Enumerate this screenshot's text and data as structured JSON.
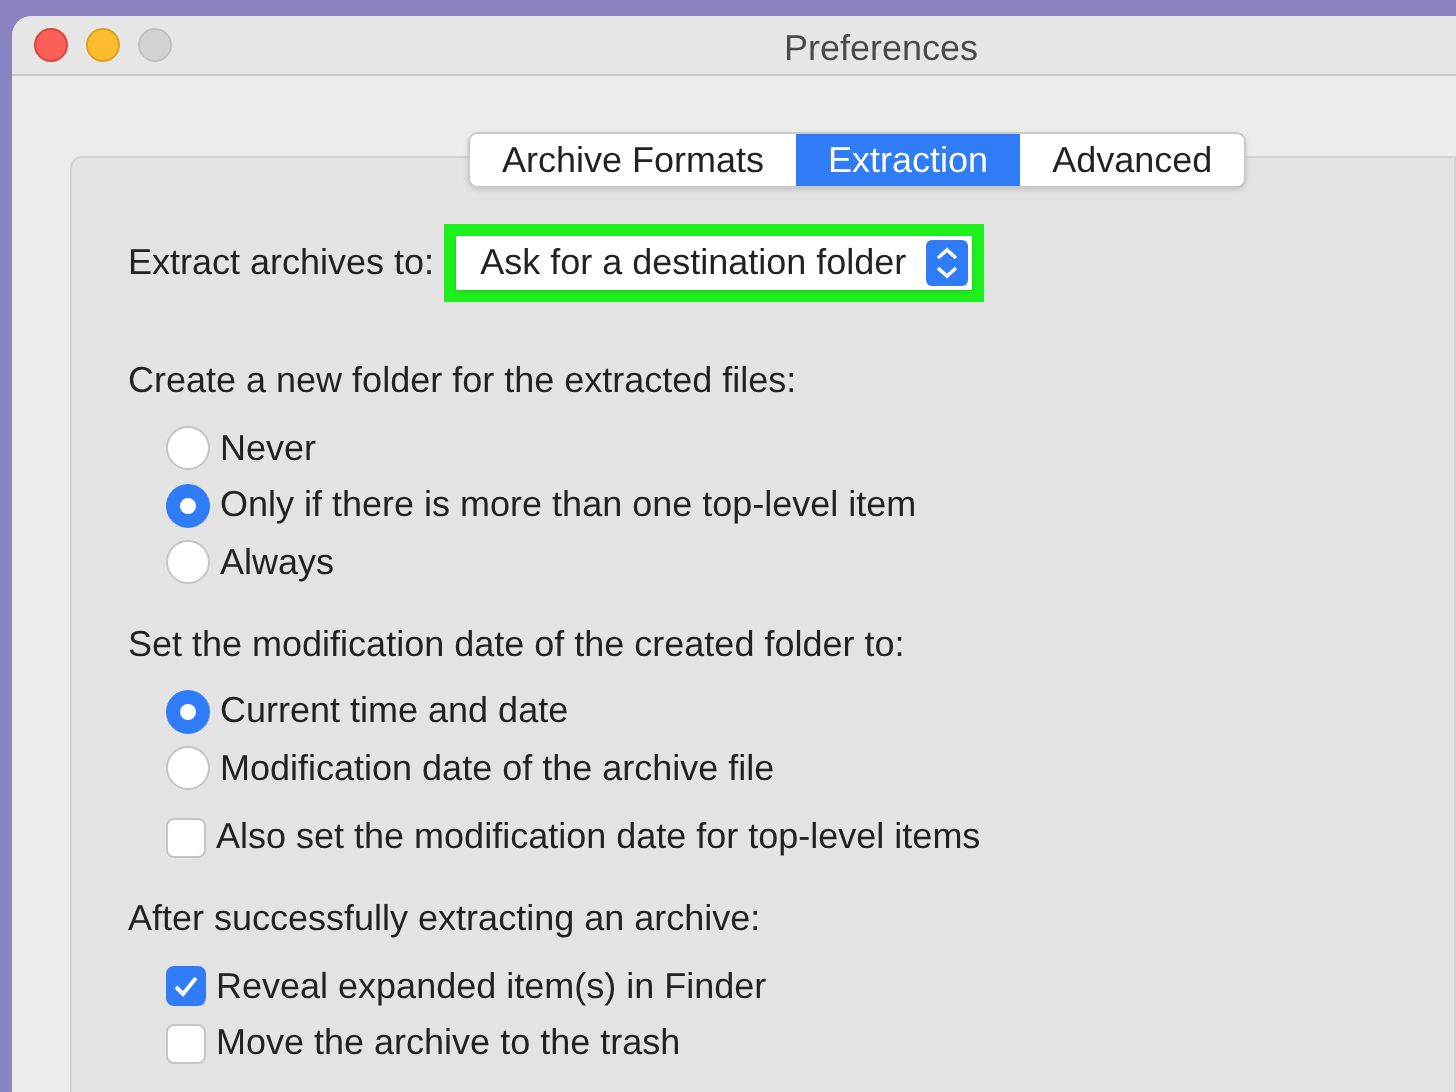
{
  "window": {
    "title": "Preferences"
  },
  "tabs": [
    {
      "label": "Archive Formats",
      "selected": false
    },
    {
      "label": "Extraction",
      "selected": true
    },
    {
      "label": "Advanced",
      "selected": false
    }
  ],
  "extract_to": {
    "label": "Extract archives to:",
    "value": "Ask for a destination folder",
    "highlighted": true
  },
  "sections": [
    {
      "heading": "Create a new folder for the extracted files:",
      "options": [
        {
          "kind": "radio",
          "label": "Never",
          "selected": false
        },
        {
          "kind": "radio",
          "label": "Only if there is more than one top-level item",
          "selected": true
        },
        {
          "kind": "radio",
          "label": "Always",
          "selected": false
        }
      ]
    },
    {
      "heading": "Set the modification date of the created folder to:",
      "options": [
        {
          "kind": "radio",
          "label": "Current time and date",
          "selected": true
        },
        {
          "kind": "radio",
          "label": "Modification date of the archive file",
          "selected": false
        },
        {
          "kind": "checkbox",
          "label": "Also set the modification date for top-level items",
          "checked": false
        }
      ]
    },
    {
      "heading": "After successfully extracting an archive:",
      "options": [
        {
          "kind": "checkbox",
          "label": "Reveal expanded item(s) in Finder",
          "checked": true
        },
        {
          "kind": "checkbox",
          "label": "Move the archive to the trash",
          "checked": false
        }
      ]
    }
  ]
}
